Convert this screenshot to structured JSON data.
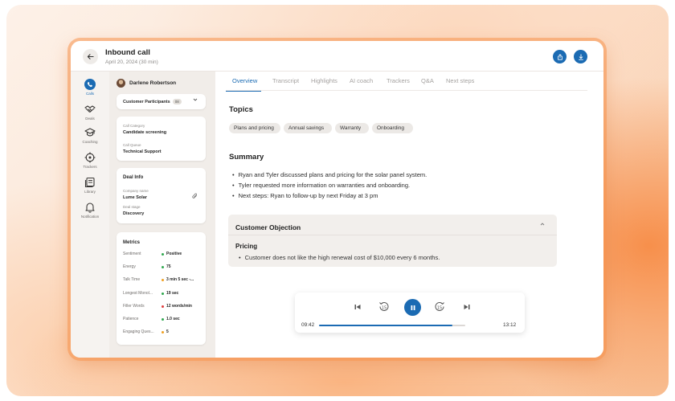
{
  "header": {
    "title": "Inbound call",
    "subtitle": "April 20, 2024  (30 min)"
  },
  "nav": {
    "items": [
      {
        "label": "Calls",
        "icon": "phone-icon",
        "active": true
      },
      {
        "label": "Deals",
        "icon": "handshake-icon"
      },
      {
        "label": "Coaching",
        "icon": "graduation-cap-icon"
      },
      {
        "label": "Trackers",
        "icon": "crosshair-icon"
      },
      {
        "label": "Library",
        "icon": "library-icon"
      },
      {
        "label": "Notification",
        "icon": "bell-icon"
      }
    ],
    "help_glyph": "?"
  },
  "side": {
    "person_name": "Darlene Robertson",
    "participants_label": "Customer Participants",
    "participants_count": "08",
    "call_category_label": "Call Category",
    "call_category_value": "Candidate screening",
    "call_queue_label": "Call Queue",
    "call_queue_value": "Technical Support",
    "deal_info_title": "Deal Info",
    "company_label": "Company name",
    "company_value": "Lume Solar",
    "deal_stage_label": "Deal stage",
    "deal_stage_value": "Discovery",
    "metrics_title": "Metrics",
    "metrics": [
      {
        "label": "Sentiment",
        "value": "Positive",
        "color": "#2fa84f"
      },
      {
        "label": "Energy",
        "value": "75",
        "color": "#2fa84f"
      },
      {
        "label": "Talk Time",
        "value": "3 min 5 sec -...",
        "color": "#f0a020"
      },
      {
        "label": "Longest Monol...",
        "value": "19 sec",
        "color": "#2fa84f"
      },
      {
        "label": "Filler Words",
        "value": "12 words/min",
        "color": "#e03c3c"
      },
      {
        "label": "Patience",
        "value": "1.0 sec",
        "color": "#2fa84f"
      },
      {
        "label": "Engaging Ques...",
        "value": "5",
        "color": "#f0a020"
      }
    ]
  },
  "tabs": [
    {
      "label": "Overview",
      "active": true
    },
    {
      "label": "Transcript"
    },
    {
      "label": "Highlights"
    },
    {
      "label": "AI coach"
    },
    {
      "label": "Trackers"
    },
    {
      "label": "Q&A"
    },
    {
      "label": "Next steps"
    }
  ],
  "topics": {
    "title": "Topics",
    "chips": [
      "Plans and pricing",
      "Annual savings",
      "Warranty",
      "Onboarding"
    ]
  },
  "summary": {
    "title": "Summary",
    "bullets": [
      "Ryan and Tyler discussed plans and pricing for the solar panel system.",
      "Tyler requested more information on warranties and onboarding.",
      "Next steps: Ryan to follow-up by next Friday at 3 pm"
    ]
  },
  "objection": {
    "title": "Customer Objection",
    "subtitle": "Pricing",
    "bullet": "Customer does not like the high renewal cost of $10,000 every 6 months."
  },
  "player": {
    "current_time": "09:42",
    "total_time": "13:12",
    "progress": 0.91,
    "skip_back_label": "15",
    "skip_forward_label": "15"
  },
  "colors": {
    "accent": "#1b6bb3",
    "positive": "#2fa84f",
    "warning": "#f0a020",
    "negative": "#e03c3c"
  }
}
